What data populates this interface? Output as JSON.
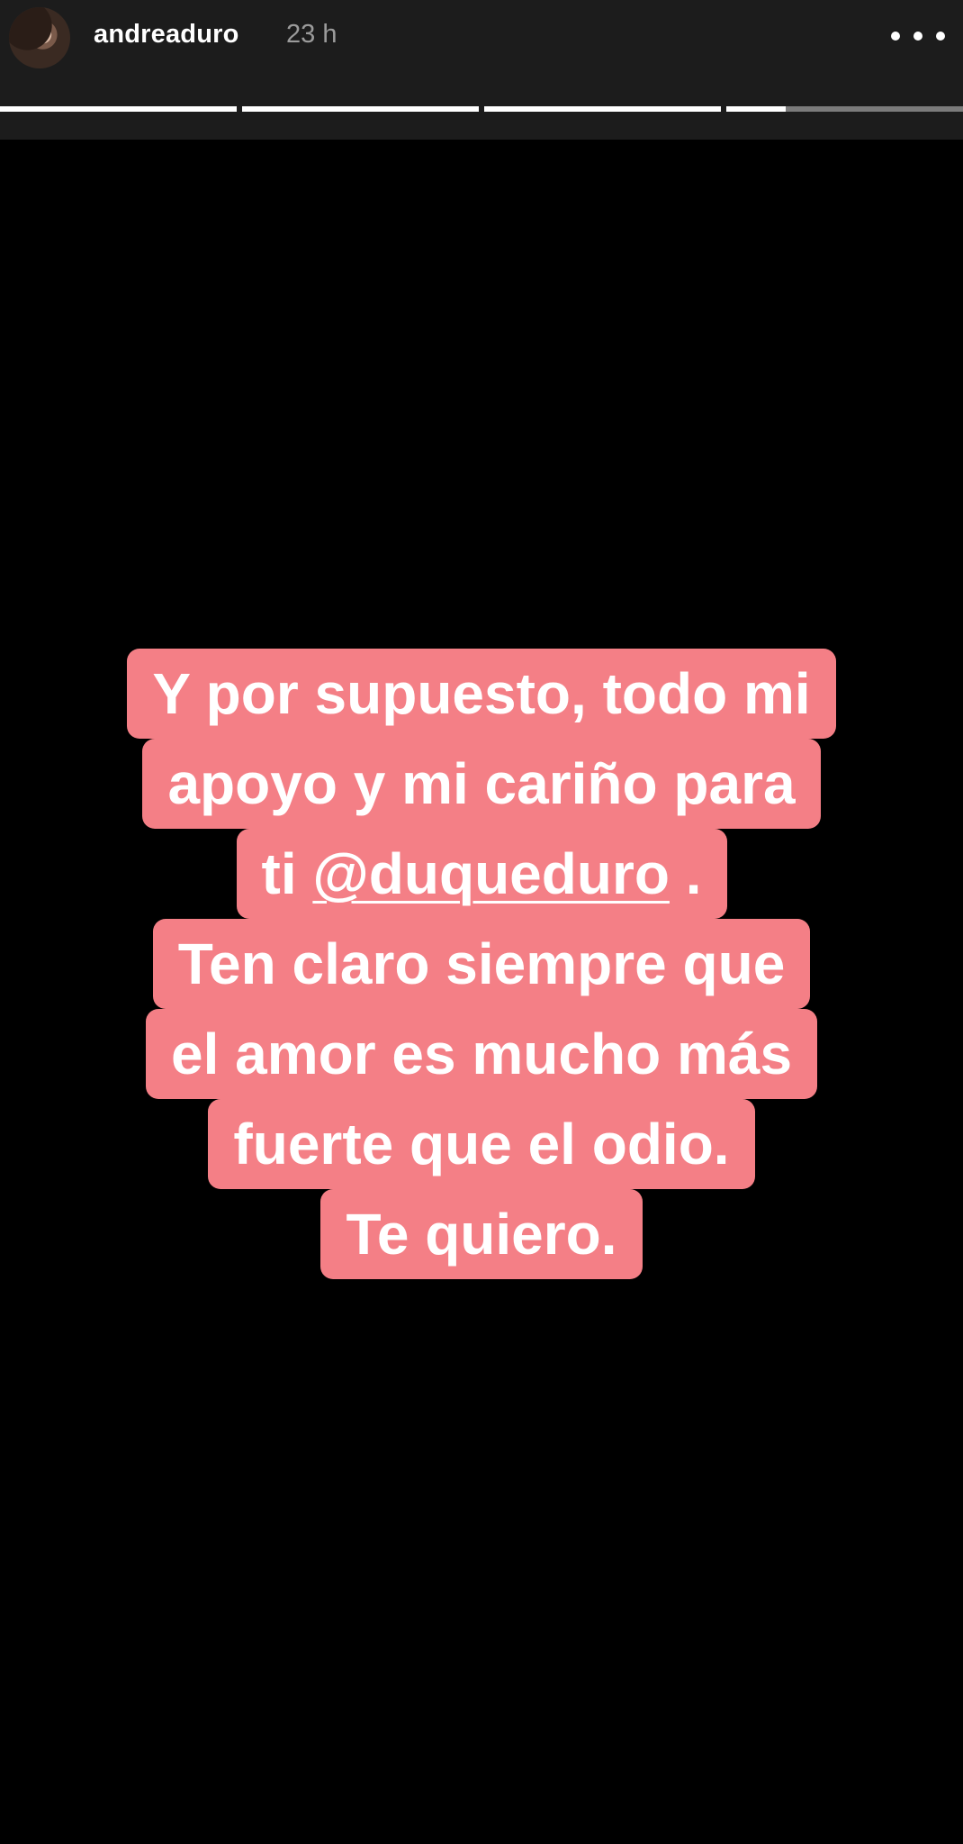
{
  "header": {
    "username": "andreaduro",
    "timestamp": "23 h",
    "more_icon": "more-horizontal-icon"
  },
  "progress": {
    "segments": [
      1,
      1,
      1,
      0.25
    ],
    "colors": {
      "filled": "#ffffff",
      "empty": "#7b7b7b"
    }
  },
  "story": {
    "background": "#000000",
    "highlight_color": "#f47f86",
    "lines": [
      {
        "text": "Y por supuesto, todo mi"
      },
      {
        "text": "apoyo y mi cariño para"
      },
      {
        "prefix": "ti ",
        "mention": "@duqueduro",
        "suffix": " ."
      },
      {
        "text": "Ten claro siempre que"
      },
      {
        "text": "el amor es mucho más"
      },
      {
        "text": "fuerte que el odio."
      },
      {
        "text": "Te quiero."
      }
    ]
  }
}
